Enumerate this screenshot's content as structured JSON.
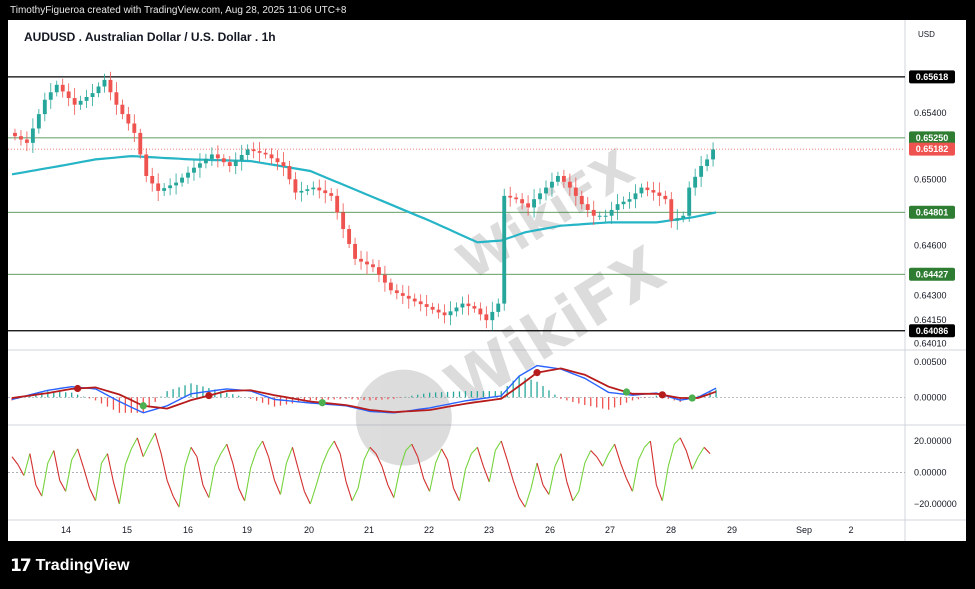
{
  "header": {
    "attribution": "TimothyFigueroa created with TradingView.com, Aug 28, 2025 11:06 UTC+8"
  },
  "symbol": {
    "title": "AUDUSD . Australian Dollar / U.S. Dollar . 1h",
    "currency": "USD"
  },
  "footer": {
    "brand": "TradingView",
    "logo_glyph": "17"
  },
  "watermark": {
    "text": "WikiFX"
  },
  "colors": {
    "bull": "#26a69a",
    "bear": "#ef5350",
    "ma": "#26b5c6",
    "level_black": "#000000",
    "level_green": "#2e7d32",
    "macd_line": "#2962ff",
    "macd_signal_up": "#4caf50",
    "macd_signal_down": "#b71c1c",
    "osc_up": "#76d33d",
    "osc_down": "#d32f2f"
  },
  "chart_data": {
    "type": "candlestick",
    "timeframe": "1h",
    "x_tick_labels": [
      "14",
      "15",
      "16",
      "19",
      "20",
      "21",
      "22",
      "23",
      "26",
      "27",
      "28",
      "29",
      "Sep",
      "2"
    ],
    "price_axis": {
      "ylim": [
        0.6397,
        0.6575
      ],
      "tick_labels": [
        "0.65400",
        "0.65000",
        "0.64600",
        "0.64300",
        "0.64150",
        "0.64010"
      ]
    },
    "tick_values": [
      0.654,
      0.65,
      0.646,
      0.643,
      0.6415,
      0.6401
    ],
    "horizontal_levels": [
      {
        "value": 0.65618,
        "label": "0.65618",
        "style": "black"
      },
      {
        "value": 0.6525,
        "label": "0.65250",
        "style": "green"
      },
      {
        "value": 0.64801,
        "label": "0.64801",
        "style": "green"
      },
      {
        "value": 0.64427,
        "label": "0.64427",
        "style": "green"
      },
      {
        "value": 0.64086,
        "label": "0.64086",
        "style": "black"
      }
    ],
    "last_price": {
      "value": 0.65182,
      "label": "0.65182"
    },
    "price_path": [
      [
        0,
        0.6528
      ],
      [
        3,
        0.6522
      ],
      [
        6,
        0.6548
      ],
      [
        8,
        0.6557
      ],
      [
        11,
        0.6545
      ],
      [
        14,
        0.6552
      ],
      [
        16,
        0.656
      ],
      [
        18,
        0.6545
      ],
      [
        21,
        0.6528
      ],
      [
        23,
        0.6502
      ],
      [
        25,
        0.6493
      ],
      [
        28,
        0.6498
      ],
      [
        31,
        0.6507
      ],
      [
        34,
        0.6515
      ],
      [
        37,
        0.6508
      ],
      [
        40,
        0.6518
      ],
      [
        43,
        0.6515
      ],
      [
        46,
        0.6508
      ],
      [
        48,
        0.6492
      ],
      [
        51,
        0.6495
      ],
      [
        54,
        0.649
      ],
      [
        56,
        0.647
      ],
      [
        58,
        0.6452
      ],
      [
        61,
        0.6447
      ],
      [
        64,
        0.6433
      ],
      [
        67,
        0.6428
      ],
      [
        70,
        0.6423
      ],
      [
        73,
        0.6418
      ],
      [
        76,
        0.6425
      ],
      [
        78,
        0.6422
      ],
      [
        80,
        0.6415
      ],
      [
        82,
        0.6425
      ],
      [
        83,
        0.649
      ],
      [
        85,
        0.6488
      ],
      [
        87,
        0.6483
      ],
      [
        88,
        0.6488
      ],
      [
        90,
        0.6495
      ],
      [
        92,
        0.6502
      ],
      [
        94,
        0.6495
      ],
      [
        96,
        0.6485
      ],
      [
        98,
        0.6478
      ],
      [
        100,
        0.6478
      ],
      [
        102,
        0.6485
      ],
      [
        104,
        0.6488
      ],
      [
        106,
        0.6495
      ],
      [
        108,
        0.6492
      ],
      [
        110,
        0.6488
      ],
      [
        111,
        0.6475
      ],
      [
        113,
        0.6478
      ],
      [
        114,
        0.6495
      ],
      [
        116,
        0.6508
      ],
      [
        117,
        0.6512
      ],
      [
        118,
        0.6518
      ]
    ],
    "ma_line": [
      [
        0,
        0.6503
      ],
      [
        8,
        0.6508
      ],
      [
        14,
        0.6512
      ],
      [
        20,
        0.6514
      ],
      [
        30,
        0.6512
      ],
      [
        40,
        0.6511
      ],
      [
        50,
        0.6505
      ],
      [
        60,
        0.649
      ],
      [
        70,
        0.6475
      ],
      [
        78,
        0.6462
      ],
      [
        82,
        0.6463
      ],
      [
        86,
        0.6468
      ],
      [
        92,
        0.6472
      ],
      [
        100,
        0.6474
      ],
      [
        108,
        0.6474
      ],
      [
        114,
        0.6477
      ],
      [
        118,
        0.648
      ]
    ],
    "macd_pane": {
      "tick_labels": [
        "0.00500",
        "0.00000"
      ],
      "tick_values": [
        0.005,
        0.0
      ],
      "ylim": [
        -0.0035,
        0.006
      ],
      "line": [
        [
          0,
          -0.0003
        ],
        [
          6,
          0.001
        ],
        [
          10,
          0.0015
        ],
        [
          14,
          0.0012
        ],
        [
          18,
          -0.0006
        ],
        [
          22,
          -0.0022
        ],
        [
          26,
          -0.0012
        ],
        [
          30,
          0.0005
        ],
        [
          36,
          0.0012
        ],
        [
          40,
          0.0009
        ],
        [
          44,
          -0.0003
        ],
        [
          50,
          -0.0008
        ],
        [
          56,
          -0.0012
        ],
        [
          60,
          -0.002
        ],
        [
          64,
          -0.0022
        ],
        [
          70,
          -0.0015
        ],
        [
          76,
          -0.0005
        ],
        [
          82,
          0.0002
        ],
        [
          85,
          0.003
        ],
        [
          88,
          0.0045
        ],
        [
          92,
          0.004
        ],
        [
          96,
          0.0027
        ],
        [
          100,
          0.0007
        ],
        [
          104,
          0.0003
        ],
        [
          108,
          0.0006
        ],
        [
          112,
          -0.0004
        ],
        [
          115,
          0.0
        ],
        [
          118,
          0.0013
        ]
      ],
      "signal": [
        [
          0,
          -0.0001
        ],
        [
          6,
          0.0006
        ],
        [
          10,
          0.0012
        ],
        [
          14,
          0.0014
        ],
        [
          18,
          0.0004
        ],
        [
          22,
          -0.0012
        ],
        [
          26,
          -0.0016
        ],
        [
          30,
          -0.0004
        ],
        [
          36,
          0.0009
        ],
        [
          40,
          0.001
        ],
        [
          44,
          0.0003
        ],
        [
          50,
          -0.0006
        ],
        [
          56,
          -0.0011
        ],
        [
          60,
          -0.0018
        ],
        [
          64,
          -0.0021
        ],
        [
          70,
          -0.0018
        ],
        [
          76,
          -0.0009
        ],
        [
          82,
          -0.0002
        ],
        [
          85,
          0.0016
        ],
        [
          88,
          0.0035
        ],
        [
          92,
          0.0041
        ],
        [
          96,
          0.0032
        ],
        [
          100,
          0.0015
        ],
        [
          104,
          0.0005
        ],
        [
          108,
          0.0005
        ],
        [
          112,
          -0.0001
        ],
        [
          115,
          -0.0001
        ],
        [
          118,
          0.0008
        ]
      ],
      "cross_markers": [
        {
          "i": 11,
          "color": "bear"
        },
        {
          "i": 22,
          "color": "bull"
        },
        {
          "i": 33,
          "color": "bear"
        },
        {
          "i": 52,
          "color": "bull"
        },
        {
          "i": 88,
          "color": "bear"
        },
        {
          "i": 103,
          "color": "bull"
        },
        {
          "i": 109,
          "color": "bear"
        },
        {
          "i": 114,
          "color": "bull"
        }
      ]
    },
    "oscillator_pane": {
      "tick_labels": [
        "20.00000",
        "0.00000",
        "−20.00000"
      ],
      "tick_values": [
        20,
        0,
        -20
      ],
      "ylim": [
        -27,
        27
      ],
      "values": [
        10,
        5,
        -2,
        12,
        -8,
        -15,
        6,
        14,
        -5,
        -12,
        8,
        15,
        3,
        -10,
        -18,
        6,
        12,
        -6,
        -20,
        5,
        15,
        22,
        10,
        18,
        25,
        12,
        -5,
        -15,
        -22,
        4,
        16,
        10,
        -8,
        -16,
        4,
        12,
        18,
        6,
        -10,
        -18,
        3,
        14,
        20,
        10,
        -5,
        -14,
        6,
        16,
        2,
        -12,
        -20,
        -8,
        5,
        14,
        20,
        12,
        -6,
        -18,
        -10,
        8,
        16,
        12,
        4,
        -8,
        -16,
        2,
        14,
        18,
        10,
        -4,
        -12,
        6,
        15,
        8,
        -10,
        -18,
        2,
        12,
        16,
        4,
        -6,
        14,
        20,
        8,
        -5,
        -16,
        -22,
        -10,
        6,
        -8,
        -14,
        4,
        12,
        -6,
        -18,
        -12,
        6,
        14,
        10,
        4,
        12,
        18,
        6,
        -4,
        -12,
        8,
        16,
        20,
        -8,
        -18,
        4,
        18,
        22,
        14,
        2,
        10,
        16,
        12
      ]
    }
  }
}
